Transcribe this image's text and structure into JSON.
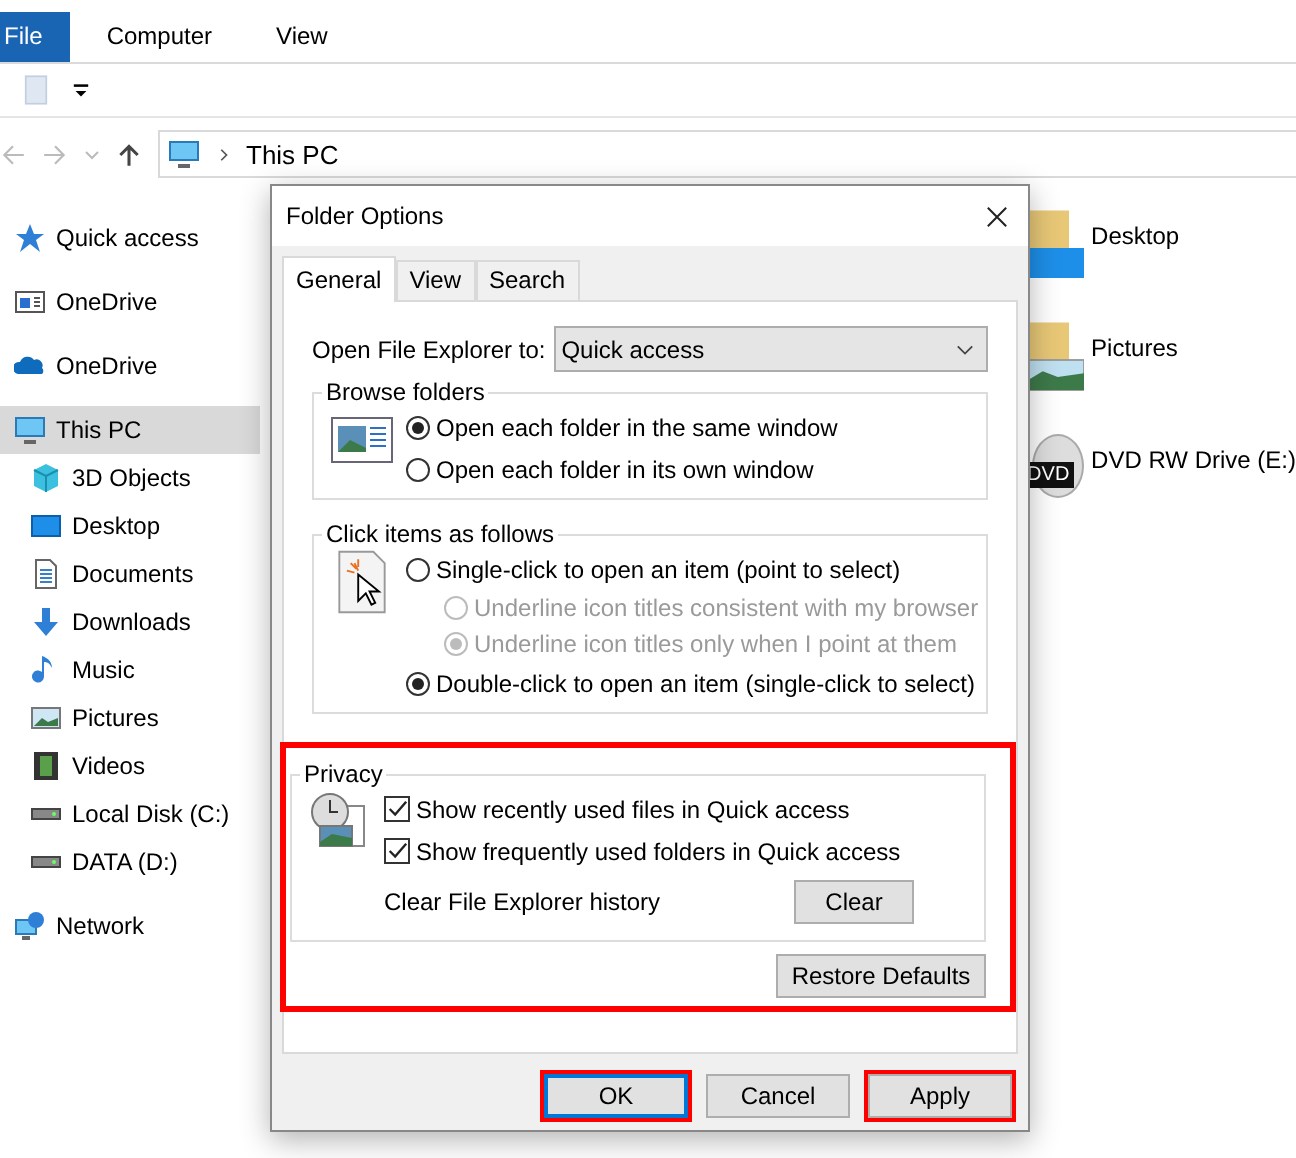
{
  "explorer": {
    "ribbon_tabs": [
      {
        "label": "File",
        "selected": true
      },
      {
        "label": "Computer",
        "selected": false
      },
      {
        "label": "View",
        "selected": false
      }
    ],
    "address": {
      "path": "This PC"
    },
    "nav": [
      {
        "label": "Quick access",
        "kind": "star",
        "selected": false
      },
      {
        "label": "OneDrive",
        "kind": "window",
        "selected": false
      },
      {
        "label": "OneDrive",
        "kind": "cloud",
        "selected": false
      },
      {
        "label": "This PC",
        "kind": "pc",
        "selected": true,
        "children": [
          {
            "label": "3D Objects",
            "kind": "cube",
            "selected": false
          },
          {
            "label": "Desktop",
            "kind": "desktop",
            "selected": false
          },
          {
            "label": "Documents",
            "kind": "document",
            "selected": false
          },
          {
            "label": "Downloads",
            "kind": "download",
            "selected": false
          },
          {
            "label": "Music",
            "kind": "music",
            "selected": false
          },
          {
            "label": "Pictures",
            "kind": "pictures",
            "selected": false
          },
          {
            "label": "Videos",
            "kind": "video",
            "selected": false
          },
          {
            "label": "Local Disk (C:)",
            "kind": "drive",
            "selected": false
          },
          {
            "label": "DATA (D:)",
            "kind": "drive",
            "selected": false
          }
        ]
      },
      {
        "label": "Network",
        "kind": "network",
        "selected": false
      }
    ],
    "items": [
      {
        "label": "Desktop",
        "kind": "desktop"
      },
      {
        "label": "Pictures",
        "kind": "pictures"
      },
      {
        "label": "DVD RW Drive (E:)",
        "kind": "dvd",
        "badge": "DVD"
      }
    ]
  },
  "dialog": {
    "title": "Folder Options",
    "tabs": [
      {
        "label": "General",
        "selected": true
      },
      {
        "label": "View",
        "selected": false
      },
      {
        "label": "Search",
        "selected": false
      }
    ],
    "open_to": {
      "label": "Open File Explorer to:",
      "value": "Quick access"
    },
    "browse_folders": {
      "title": "Browse folders",
      "options": [
        {
          "label": "Open each folder in the same window",
          "selected": true
        },
        {
          "label": "Open each folder in its own window",
          "selected": false
        }
      ]
    },
    "click_items": {
      "title": "Click items as follows",
      "options": [
        {
          "label": "Single-click to open an item (point to select)",
          "selected": false,
          "children": [
            {
              "label": "Underline icon titles consistent with my browser",
              "selected": false,
              "disabled": true
            },
            {
              "label": "Underline icon titles only when I point at them",
              "selected": true,
              "disabled": true
            }
          ]
        },
        {
          "label": "Double-click to open an item (single-click to select)",
          "selected": true
        }
      ]
    },
    "privacy": {
      "title": "Privacy",
      "highlighted": true,
      "checkboxes": [
        {
          "label": "Show recently used files in Quick access",
          "checked": true
        },
        {
          "label": "Show frequently used folders in Quick access",
          "checked": true
        }
      ],
      "clear_label": "Clear File Explorer history",
      "clear_button": "Clear",
      "restore_button": "Restore Defaults"
    },
    "buttons": [
      {
        "label": "OK",
        "highlighted": true,
        "default": true
      },
      {
        "label": "Cancel",
        "highlighted": false,
        "default": false
      },
      {
        "label": "Apply",
        "highlighted": true,
        "default": false
      }
    ]
  }
}
